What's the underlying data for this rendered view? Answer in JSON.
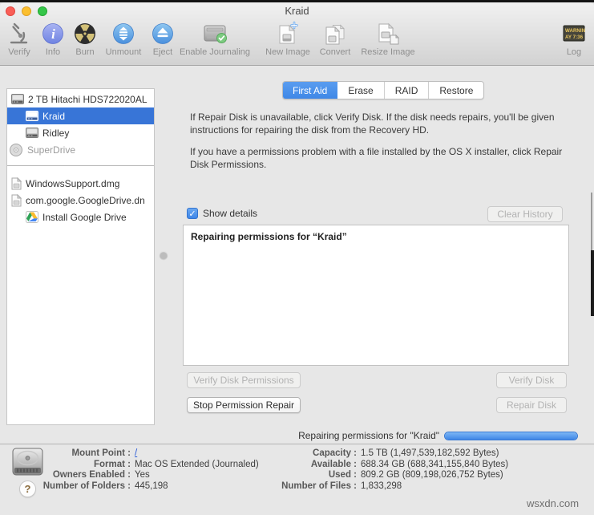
{
  "window": {
    "title": "Kraid"
  },
  "toolbar": {
    "items": [
      {
        "label": "Verify"
      },
      {
        "label": "Info"
      },
      {
        "label": "Burn"
      },
      {
        "label": "Unmount"
      },
      {
        "label": "Eject"
      },
      {
        "label": "Enable Journaling"
      },
      {
        "label": "New Image"
      },
      {
        "label": "Convert"
      },
      {
        "label": "Resize Image"
      },
      {
        "label": "Log"
      }
    ],
    "log_icon": {
      "line1": "WARNIN",
      "line2": "AY 7:36"
    }
  },
  "sidebar": {
    "devices": [
      {
        "label": "2 TB Hitachi HDS722020AL",
        "selected": false
      },
      {
        "label": "Kraid",
        "selected": true
      },
      {
        "label": "Ridley",
        "selected": false
      },
      {
        "label": "SuperDrive",
        "selected": false
      }
    ],
    "images": [
      {
        "label": "WindowsSupport.dmg"
      },
      {
        "label": "com.google.GoogleDrive.dn"
      },
      {
        "label": "Install Google Drive"
      }
    ]
  },
  "tabs": [
    {
      "label": "First Aid",
      "selected": true
    },
    {
      "label": "Erase",
      "selected": false
    },
    {
      "label": "RAID",
      "selected": false
    },
    {
      "label": "Restore",
      "selected": false
    }
  ],
  "first_aid": {
    "paragraph1": "If Repair Disk is unavailable, click Verify Disk. If the disk needs repairs, you'll be given instructions for repairing the disk from the Recovery HD.",
    "paragraph2": "If you have a permissions problem with a file installed by the OS X installer, click Repair Disk Permissions.",
    "show_details_label": "Show details",
    "show_details_checked": true,
    "checkmark": "✓",
    "clear_history_label": "Clear History",
    "details_log": "Repairing permissions for “Kraid”",
    "buttons": {
      "verify_permissions": "Verify Disk Permissions",
      "stop_permission_repair": "Stop Permission Repair",
      "verify_disk": "Verify Disk",
      "repair_disk": "Repair Disk"
    }
  },
  "status": {
    "text": "Repairing permissions for \"Kraid\"",
    "progress_percent": 100
  },
  "info": {
    "left": [
      {
        "label": "Mount Point :",
        "value": "/"
      },
      {
        "label": "Format :",
        "value": "Mac OS Extended (Journaled)"
      },
      {
        "label": "Owners Enabled :",
        "value": "Yes"
      },
      {
        "label": "Number of Folders :",
        "value": "445,198"
      }
    ],
    "right": [
      {
        "label": "Capacity :",
        "value": "1.5 TB (1,497,539,182,592 Bytes)"
      },
      {
        "label": "Available :",
        "value": "688.34 GB (688,341,155,840 Bytes)"
      },
      {
        "label": "Used :",
        "value": "809.2 GB (809,198,026,752 Bytes)"
      },
      {
        "label": "Number of Files :",
        "value": "1,833,298"
      }
    ]
  },
  "footer": {
    "help_label": "?",
    "watermark": "wsxdn.com"
  },
  "colors": {
    "selection_blue": "#3875d7",
    "tab_blue": "#4a90e8",
    "progress_blue": "#3f86e6",
    "link_blue": "#2a5bd7"
  }
}
